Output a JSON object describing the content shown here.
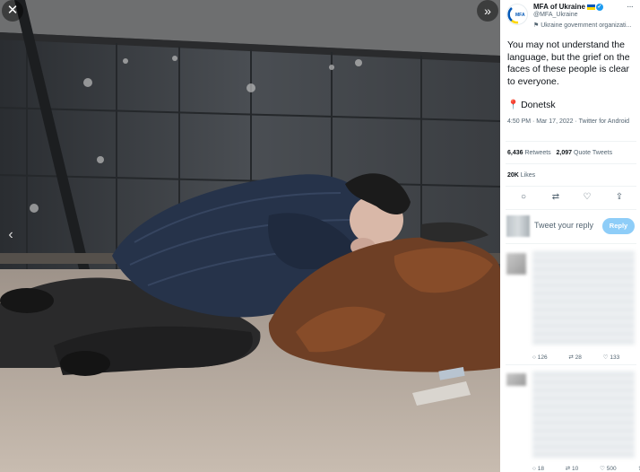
{
  "media": {
    "close_icon": "close-icon",
    "expand_icon": "expand-icon",
    "prev_icon": "chevron-left-icon"
  },
  "account": {
    "name": "MFA of Ukraine",
    "handle": "@MFA_Ukraine",
    "label": "Ukraine government organizati...",
    "logo_text": "MFA"
  },
  "tweet": {
    "text": "You may not understand the language, but the grief on the faces of these people is clear to everyone.",
    "location": "Donetsk",
    "time": "4:50 PM · Mar 17, 2022 · Twitter for Android"
  },
  "stats": {
    "retweets_count": "6,436",
    "retweets_label": "Retweets",
    "quotes_count": "2,097",
    "quotes_label": "Quote Tweets",
    "likes_count": "20K",
    "likes_label": "Likes"
  },
  "reply": {
    "placeholder": "Tweet your reply",
    "button": "Reply"
  },
  "replies": [
    {
      "replies": "126",
      "retweets": "28",
      "likes": "133"
    },
    {
      "replies": "18",
      "retweets": "10",
      "likes": "500"
    }
  ],
  "colors": {
    "accent": "#1d9bf0",
    "reply_button": "#8ecdf8"
  }
}
